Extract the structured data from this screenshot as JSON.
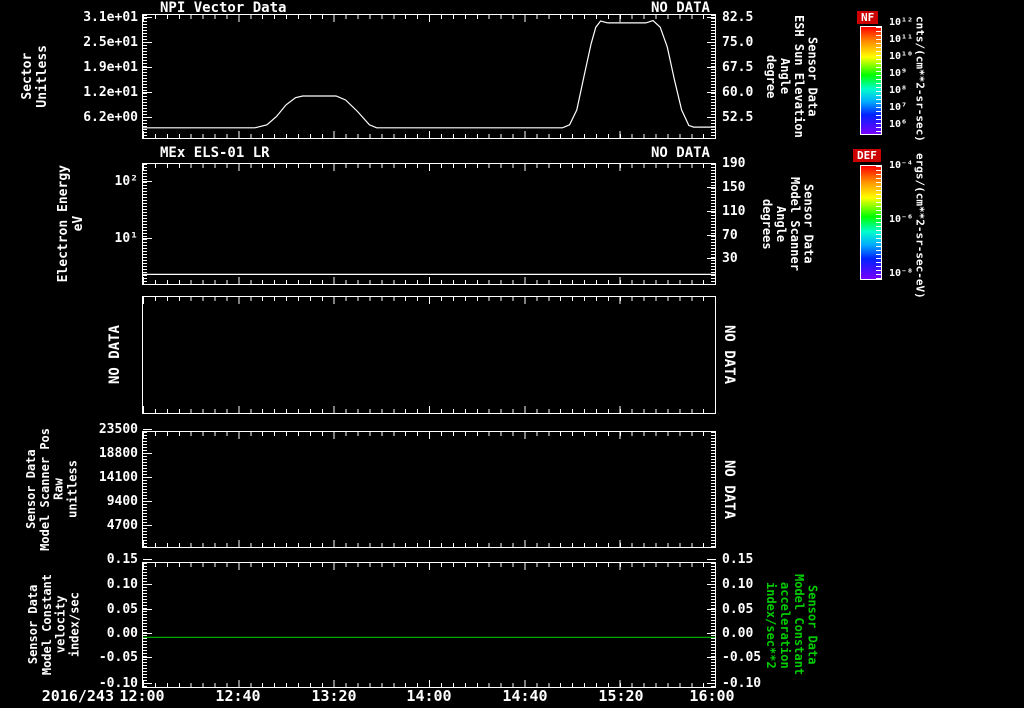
{
  "colors": {
    "background": "#000000",
    "foreground": "#ffffff",
    "green_label": "#00cc00",
    "green_line": "#00a800",
    "colorbar_title_bg": "#cc0000"
  },
  "panel1": {
    "title": "NPI Vector Data",
    "no_data": "NO DATA",
    "left_axis": {
      "label": "Sector\nUnitless",
      "ticks": [
        "3.1e+01",
        "2.5e+01",
        "1.9e+01",
        "1.2e+01",
        "6.2e+00"
      ]
    },
    "right_axis": {
      "label": "Sensor Data\nESH Sun Elevation\nAngle\ndegree",
      "ticks": [
        "82.5",
        "75.0",
        "67.5",
        "60.0",
        "52.5"
      ]
    }
  },
  "panel2": {
    "title": "MEx ELS-01 LR",
    "no_data": "NO DATA",
    "left_axis": {
      "label": "Electron Energy\neV",
      "ticks": [
        "10²",
        "10¹"
      ]
    },
    "right_axis": {
      "label": "Sensor Data\nModel Scanner\nAngle\ndegrees",
      "ticks": [
        "190",
        "150",
        "110",
        "70",
        "30"
      ]
    }
  },
  "panel3": {
    "left_no_data": "NO DATA",
    "right_no_data": "NO DATA"
  },
  "panel4": {
    "left_axis": {
      "label": "Sensor Data\nModel Scanner Pos\nRaw\nunitless",
      "ticks": [
        "23500",
        "18800",
        "14100",
        "9400",
        "4700"
      ]
    },
    "right_no_data": "NO DATA"
  },
  "panel5": {
    "left_axis": {
      "label": "Sensor Data\nModel Constant\nvelocity\nindex/sec",
      "ticks": [
        "0.15",
        "0.10",
        "0.05",
        "0.00",
        "-0.05",
        "-0.10"
      ]
    },
    "right_axis": {
      "label": "Sensor Data\nModel Constant\nacceleration\nindex/sec**2",
      "ticks": [
        "0.15",
        "0.10",
        "0.05",
        "0.00",
        "-0.05",
        "-0.10"
      ]
    }
  },
  "xaxis": {
    "date": "2016/243",
    "labels": [
      "12:00",
      "12:40",
      "13:20",
      "14:00",
      "14:40",
      "15:20",
      "16:00"
    ]
  },
  "colorbars": [
    {
      "title": "NF",
      "units": "cnts/(cm**2-sr-sec)",
      "ticks": [
        "10¹²",
        "10¹¹",
        "10¹⁰",
        "10⁹",
        "10⁸",
        "10⁷",
        "10⁶"
      ]
    },
    {
      "title": "DEF",
      "units": "ergs/(cm**2-sr-sec-eV)",
      "ticks": [
        "10⁻⁴",
        "10⁻⁶",
        "10⁻⁸"
      ]
    }
  ],
  "chart_data": [
    {
      "type": "line",
      "title": "NPI Vector Data",
      "status": "NO DATA",
      "x_unit": "minutes after 12:00 UT on 2016/243",
      "x_range": [
        0,
        240
      ],
      "x_tick_labels": [
        "12:00",
        "12:40",
        "13:20",
        "14:00",
        "14:40",
        "15:20",
        "16:00"
      ],
      "left_axis": {
        "label": "Sector (Unitless)",
        "tick_values": [
          31,
          25,
          19,
          12,
          6.2
        ]
      },
      "right_axis": {
        "label": "Sensor Data ESH Sun Elevation Angle (degree)",
        "tick_values": [
          82.5,
          75.0,
          67.5,
          60.0,
          52.5
        ],
        "range": [
          46.5,
          83.7
        ]
      },
      "series": [
        {
          "name": "ESH Sun Elevation Angle",
          "axis": "right",
          "color": "#ffffff",
          "y_scale": "linear",
          "y_range": [
            46.5,
            83.7
          ],
          "points": [
            [
              0,
              49.6
            ],
            [
              47,
              49.6
            ],
            [
              52,
              50.5
            ],
            [
              56,
              53
            ],
            [
              60,
              56.5
            ],
            [
              64,
              58.7
            ],
            [
              67,
              59.2
            ],
            [
              81,
              59.2
            ],
            [
              85,
              58
            ],
            [
              90,
              54.5
            ],
            [
              95,
              50.5
            ],
            [
              98,
              49.6
            ],
            [
              176,
              49.6
            ],
            [
              179,
              50.5
            ],
            [
              182,
              55
            ],
            [
              185,
              65
            ],
            [
              188,
              75
            ],
            [
              190,
              80
            ],
            [
              192,
              81.9
            ],
            [
              195,
              81.3
            ],
            [
              211,
              81.3
            ],
            [
              214,
              82
            ],
            [
              217,
              80
            ],
            [
              220,
              74
            ],
            [
              223,
              64
            ],
            [
              226,
              55
            ],
            [
              229,
              50.3
            ],
            [
              231,
              49.8
            ],
            [
              240,
              49.8
            ]
          ]
        }
      ]
    },
    {
      "type": "spectrogram",
      "title": "MEx ELS-01 LR",
      "status": "NO DATA",
      "x_range": [
        0,
        240
      ],
      "left_axis": {
        "label": "Electron Energy (eV)",
        "scale": "log",
        "tick_values": [
          100,
          10
        ],
        "range": [
          1.8,
          178
        ]
      },
      "right_axis": {
        "label": "Sensor Data Model Scanner Angle (degrees)",
        "tick_values": [
          190,
          150,
          110,
          70,
          30
        ]
      },
      "series": [
        {
          "name": "lowest energy bin trace",
          "color": "#ffffff",
          "y_scale": "log",
          "y_range": [
            1.8,
            178
          ],
          "points": [
            [
              0,
              2.6
            ],
            [
              240,
              2.6
            ]
          ]
        }
      ]
    },
    {
      "type": "empty",
      "status": "NO DATA",
      "x_range": [
        0,
        240
      ]
    },
    {
      "type": "empty",
      "status": "NO DATA",
      "x_range": [
        0,
        240
      ],
      "left_axis": {
        "label": "Sensor Data Model Scanner Pos Raw (unitless)",
        "tick_values": [
          23500,
          18800,
          14100,
          9400,
          4700
        ]
      }
    },
    {
      "type": "line",
      "x_range": [
        0,
        240
      ],
      "left_axis": {
        "label": "Sensor Data Model Constant velocity (index/sec)",
        "tick_values": [
          0.15,
          0.1,
          0.05,
          0.0,
          -0.05,
          -0.1
        ],
        "range": [
          -0.1,
          0.15
        ]
      },
      "right_axis": {
        "label": "Sensor Data Model Constant acceleration (index/sec**2)",
        "tick_values": [
          0.15,
          0.1,
          0.05,
          0.0,
          -0.05,
          -0.1
        ],
        "range": [
          -0.1,
          0.15
        ]
      },
      "series": [
        {
          "name": "Model Constant velocity",
          "color": "#00a800",
          "y_scale": "linear",
          "y_range": [
            -0.1,
            0.15
          ],
          "points": [
            [
              0,
              0.0
            ],
            [
              240,
              0.0
            ]
          ]
        }
      ]
    }
  ]
}
